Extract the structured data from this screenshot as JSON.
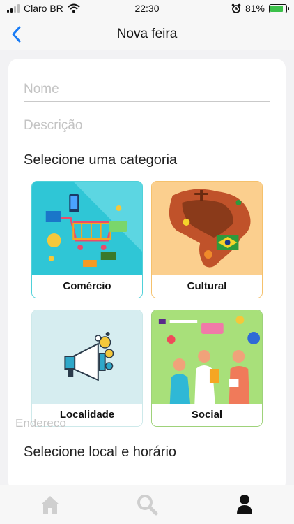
{
  "status_bar": {
    "carrier": "Claro BR",
    "time": "22:30",
    "battery": "81%",
    "battery_level": 0.81,
    "icons": [
      "signal-icon",
      "wifi-icon",
      "alarm-icon",
      "battery-icon"
    ]
  },
  "nav": {
    "title": "Nova feira",
    "back_icon": "chevron-left-icon"
  },
  "form": {
    "name_placeholder": "Nome",
    "description_placeholder": "Descrição",
    "category_heading": "Selecione uma categoria",
    "categories": [
      {
        "label": "Comércio",
        "border": "#4fd1d9"
      },
      {
        "label": "Cultural",
        "border": "#f5c16c"
      },
      {
        "label": "Localidade",
        "border": "#cde9ea"
      },
      {
        "label": "Social",
        "border": "#9ed27a"
      }
    ],
    "location_heading": "Selecione local e horário",
    "address_placeholder": "Endereco"
  },
  "tabbar": {
    "items": [
      {
        "icon": "home-icon",
        "active": false
      },
      {
        "icon": "search-icon",
        "active": false
      },
      {
        "icon": "user-icon",
        "active": true
      }
    ]
  },
  "colors": {
    "accent": "#1a7cf5",
    "tab_inactive": "#cfcfcf",
    "tab_active": "#111111"
  }
}
